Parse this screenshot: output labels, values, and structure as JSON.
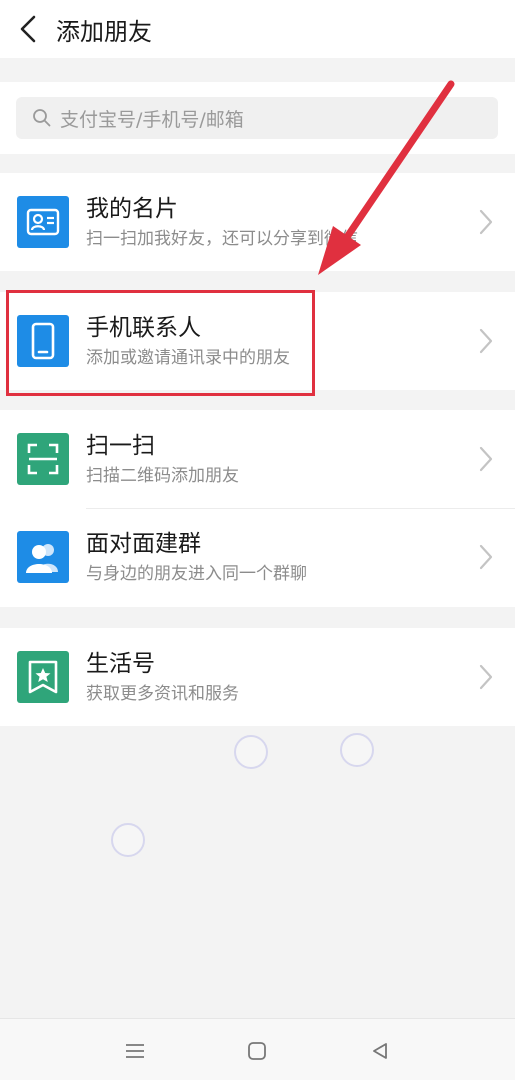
{
  "header": {
    "title": "添加朋友"
  },
  "search": {
    "placeholder": "支付宝号/手机号/邮箱"
  },
  "sections": [
    {
      "items": [
        {
          "title": "我的名片",
          "subtitle": "扫一扫加我好友，还可以分享到微信",
          "icon": "contact-card-icon",
          "icon_color": "#1e8ce6"
        }
      ]
    },
    {
      "items": [
        {
          "title": "手机联系人",
          "subtitle": "添加或邀请通讯录中的朋友",
          "icon": "phone-icon",
          "icon_color": "#1e8ce6"
        }
      ]
    },
    {
      "items": [
        {
          "title": "扫一扫",
          "subtitle": "扫描二维码添加朋友",
          "icon": "scan-icon",
          "icon_color": "#2fa57a"
        },
        {
          "title": "面对面建群",
          "subtitle": "与身边的朋友进入同一个群聊",
          "icon": "group-icon",
          "icon_color": "#1e8ce6"
        }
      ]
    },
    {
      "items": [
        {
          "title": "生活号",
          "subtitle": "获取更多资讯和服务",
          "icon": "bookmark-star-icon",
          "icon_color": "#2fa57a"
        }
      ]
    }
  ],
  "annotation": {
    "highlight_color": "#e0303f"
  },
  "navbar": {
    "buttons": [
      "menu-icon",
      "home-icon",
      "back-triangle-icon"
    ]
  }
}
